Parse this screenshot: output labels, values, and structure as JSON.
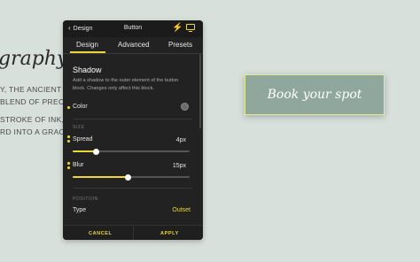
{
  "background": {
    "heading": "graphy a",
    "lines": [
      "Y, THE ANCIENT ART",
      "BLEND OF PRECISI",
      "STROKE OF INK, CA",
      "RD INTO A GRACEF"
    ],
    "cta_button": "Book your spot"
  },
  "panel": {
    "back_label": "Design",
    "title": "Button",
    "tabs": [
      "Design",
      "Advanced",
      "Presets"
    ],
    "section": {
      "title": "Shadow",
      "description": "Add a shadow to the outer element of the button block. Changes only affect this block."
    },
    "color_label": "Color",
    "size_caption": "SIZE",
    "spread": {
      "label": "Spread",
      "value": "4px",
      "fraction": 0.2
    },
    "blur": {
      "label": "Blur",
      "value": "15px",
      "fraction": 0.47
    },
    "position_caption": "POSITION",
    "type": {
      "label": "Type",
      "value": "Outset"
    },
    "footer": {
      "cancel": "CANCEL",
      "apply": "APPLY"
    }
  },
  "colors": {
    "accent": "#e9d838",
    "panel_bg": "#222222",
    "button_bg": "#8fa79d",
    "page_bg": "#d8e0dc"
  },
  "icons": [
    "chevron-left-icon",
    "bolt-icon",
    "monitor-icon"
  ]
}
